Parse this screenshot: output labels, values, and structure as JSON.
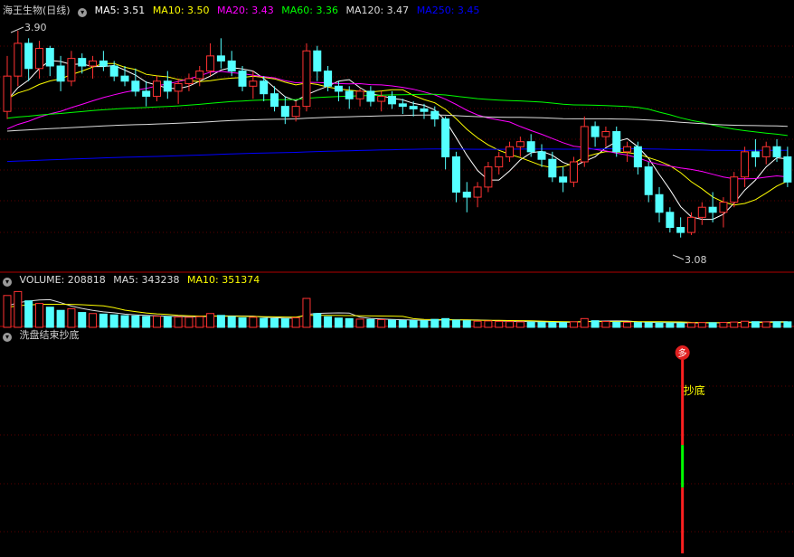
{
  "colors": {
    "background": "#000000",
    "panel_border": "#b00000",
    "grid": "#5a0000",
    "up": "#ff3232",
    "down": "#54ffff",
    "text": "#d0d0d0",
    "ma5": "#ffffff",
    "ma10": "#ffff00",
    "ma20": "#ff00ff",
    "ma60": "#00ff00",
    "ma120": "#dcdcdc",
    "ma250": "#0000ff"
  },
  "price_panel": {
    "stock_name": "海王生物(日线)",
    "ma_labels": [
      {
        "text": "MA5: 3.51",
        "color": "#ffffff"
      },
      {
        "text": "MA10: 3.50",
        "color": "#ffff00"
      },
      {
        "text": "MA20: 3.43",
        "color": "#ff00ff"
      },
      {
        "text": "MA60: 3.36",
        "color": "#00ff00"
      },
      {
        "text": "MA120: 3.47",
        "color": "#dcdcdc"
      },
      {
        "text": "MA250: 3.45",
        "color": "#0000ff"
      }
    ],
    "high_label": "3.90",
    "low_label": "3.08"
  },
  "volume_panel": {
    "labels": [
      {
        "text": "VOLUME: 208818",
        "color": "#dcdcdc"
      },
      {
        "text": "MA5: 343238",
        "color": "#dcdcdc"
      },
      {
        "text": "MA10: 351374",
        "color": "#ffff00"
      }
    ]
  },
  "indicator_panel": {
    "title": "洗盘结束抄底",
    "signal_marker": "多",
    "signal_label": "抄底"
  },
  "chart_data": {
    "type": "candlestick",
    "ylim": [
      3.0,
      3.95
    ],
    "volume_ylim": [
      0,
      1500000
    ],
    "ohlc": [
      [
        3.58,
        3.8,
        3.55,
        3.72
      ],
      [
        3.72,
        3.9,
        3.68,
        3.85
      ],
      [
        3.85,
        3.87,
        3.7,
        3.75
      ],
      [
        3.75,
        3.86,
        3.71,
        3.83
      ],
      [
        3.83,
        3.84,
        3.72,
        3.76
      ],
      [
        3.76,
        3.8,
        3.66,
        3.7
      ],
      [
        3.7,
        3.82,
        3.68,
        3.79
      ],
      [
        3.79,
        3.81,
        3.73,
        3.76
      ],
      [
        3.76,
        3.8,
        3.71,
        3.78
      ],
      [
        3.78,
        3.82,
        3.74,
        3.76
      ],
      [
        3.76,
        3.78,
        3.7,
        3.72
      ],
      [
        3.72,
        3.76,
        3.68,
        3.7
      ],
      [
        3.7,
        3.75,
        3.64,
        3.66
      ],
      [
        3.66,
        3.7,
        3.6,
        3.64
      ],
      [
        3.64,
        3.72,
        3.62,
        3.7
      ],
      [
        3.7,
        3.74,
        3.63,
        3.66
      ],
      [
        3.66,
        3.71,
        3.61,
        3.69
      ],
      [
        3.69,
        3.73,
        3.66,
        3.71
      ],
      [
        3.71,
        3.76,
        3.68,
        3.74
      ],
      [
        3.74,
        3.85,
        3.72,
        3.8
      ],
      [
        3.8,
        3.87,
        3.75,
        3.78
      ],
      [
        3.78,
        3.82,
        3.72,
        3.74
      ],
      [
        3.74,
        3.76,
        3.66,
        3.68
      ],
      [
        3.68,
        3.74,
        3.63,
        3.7
      ],
      [
        3.7,
        3.72,
        3.62,
        3.65
      ],
      [
        3.65,
        3.68,
        3.58,
        3.6
      ],
      [
        3.6,
        3.64,
        3.53,
        3.56
      ],
      [
        3.56,
        3.62,
        3.54,
        3.6
      ],
      [
        3.6,
        3.85,
        3.58,
        3.82
      ],
      [
        3.82,
        3.84,
        3.7,
        3.74
      ],
      [
        3.74,
        3.76,
        3.66,
        3.68
      ],
      [
        3.68,
        3.7,
        3.62,
        3.66
      ],
      [
        3.66,
        3.68,
        3.59,
        3.63
      ],
      [
        3.63,
        3.67,
        3.6,
        3.66
      ],
      [
        3.66,
        3.68,
        3.6,
        3.62
      ],
      [
        3.62,
        3.66,
        3.58,
        3.64
      ],
      [
        3.64,
        3.66,
        3.59,
        3.61
      ],
      [
        3.61,
        3.63,
        3.57,
        3.6
      ],
      [
        3.6,
        3.62,
        3.56,
        3.59
      ],
      [
        3.59,
        3.61,
        3.55,
        3.58
      ],
      [
        3.58,
        3.6,
        3.52,
        3.55
      ],
      [
        3.55,
        3.56,
        3.35,
        3.4
      ],
      [
        3.4,
        3.42,
        3.22,
        3.26
      ],
      [
        3.26,
        3.3,
        3.18,
        3.24
      ],
      [
        3.24,
        3.3,
        3.2,
        3.28
      ],
      [
        3.28,
        3.38,
        3.26,
        3.36
      ],
      [
        3.36,
        3.42,
        3.33,
        3.4
      ],
      [
        3.4,
        3.46,
        3.38,
        3.44
      ],
      [
        3.44,
        3.48,
        3.4,
        3.46
      ],
      [
        3.46,
        3.49,
        3.4,
        3.42
      ],
      [
        3.42,
        3.45,
        3.36,
        3.39
      ],
      [
        3.39,
        3.42,
        3.3,
        3.32
      ],
      [
        3.32,
        3.36,
        3.26,
        3.3
      ],
      [
        3.3,
        3.4,
        3.28,
        3.38
      ],
      [
        3.38,
        3.56,
        3.36,
        3.52
      ],
      [
        3.52,
        3.54,
        3.44,
        3.48
      ],
      [
        3.48,
        3.52,
        3.44,
        3.5
      ],
      [
        3.5,
        3.52,
        3.4,
        3.42
      ],
      [
        3.42,
        3.46,
        3.38,
        3.44
      ],
      [
        3.44,
        3.46,
        3.33,
        3.36
      ],
      [
        3.36,
        3.38,
        3.22,
        3.25
      ],
      [
        3.25,
        3.28,
        3.14,
        3.18
      ],
      [
        3.18,
        3.2,
        3.1,
        3.12
      ],
      [
        3.12,
        3.16,
        3.08,
        3.1
      ],
      [
        3.1,
        3.18,
        3.09,
        3.16
      ],
      [
        3.16,
        3.22,
        3.13,
        3.2
      ],
      [
        3.2,
        3.26,
        3.14,
        3.18
      ],
      [
        3.18,
        3.24,
        3.12,
        3.22
      ],
      [
        3.22,
        3.34,
        3.2,
        3.32
      ],
      [
        3.32,
        3.44,
        3.28,
        3.42
      ],
      [
        3.42,
        3.47,
        3.36,
        3.4
      ],
      [
        3.4,
        3.46,
        3.37,
        3.44
      ],
      [
        3.44,
        3.47,
        3.38,
        3.4
      ],
      [
        3.4,
        3.44,
        3.28,
        3.3
      ]
    ],
    "volume": [
      1200000,
      1350000,
      1000000,
      900000,
      760000,
      640000,
      700000,
      560000,
      520000,
      500000,
      470000,
      440000,
      430000,
      410000,
      420000,
      400000,
      390000,
      380000,
      400000,
      520000,
      450000,
      400000,
      360000,
      380000,
      340000,
      330000,
      320000,
      360000,
      1090000,
      520000,
      400000,
      350000,
      330000,
      310000,
      300000,
      290000,
      270000,
      260000,
      255000,
      250000,
      300000,
      330000,
      270000,
      250000,
      230000,
      240000,
      225000,
      215000,
      205000,
      200000,
      190000,
      185000,
      180000,
      210000,
      330000,
      250000,
      220000,
      195000,
      190000,
      180000,
      175000,
      170000,
      165000,
      160000,
      170000,
      180000,
      175000,
      185000,
      200000,
      230000,
      215000,
      205000,
      210000,
      208818
    ],
    "signal_index": 63,
    "signal_segment": [
      {
        "length_fraction": 0.44,
        "color": "#ff2020"
      },
      {
        "length_fraction": 0.22,
        "color": "#00ff00"
      },
      {
        "length_fraction": 0.34,
        "color": "#ff2020"
      }
    ]
  }
}
